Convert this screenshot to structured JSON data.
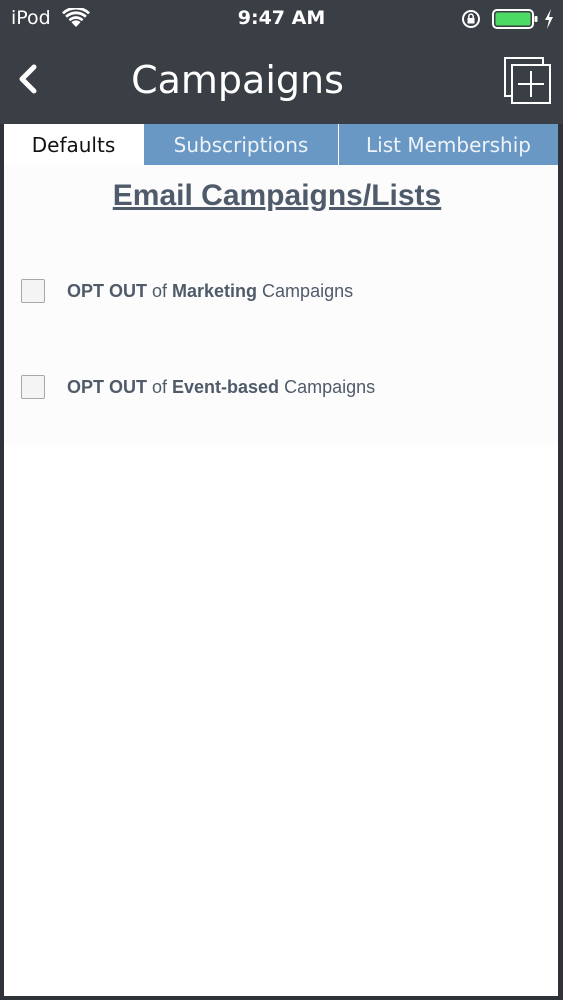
{
  "status_bar": {
    "carrier": "iPod",
    "time": "9:47 AM",
    "battery_color": "#4cd964"
  },
  "nav": {
    "title": "Campaigns",
    "back_icon": "chevron-left-icon",
    "add_icon": "add-window-icon"
  },
  "tabs": [
    {
      "label": "Defaults",
      "active": true
    },
    {
      "label": "Subscriptions",
      "active": false
    },
    {
      "label": "List Membership",
      "active": false
    }
  ],
  "section": {
    "heading": "Email Campaigns/Lists"
  },
  "options": [
    {
      "prefix": "OPT OUT",
      "of": " of ",
      "type": "Marketing",
      "suffix": " Campaigns",
      "checked": false
    },
    {
      "prefix": "OPT OUT",
      "of": " of ",
      "type": "Event-based",
      "suffix": " Campaigns",
      "checked": false
    }
  ],
  "colors": {
    "nav_background": "#3a3e45",
    "tab_inactive": "#6a98c4",
    "heading_text": "#4f5b6b"
  }
}
